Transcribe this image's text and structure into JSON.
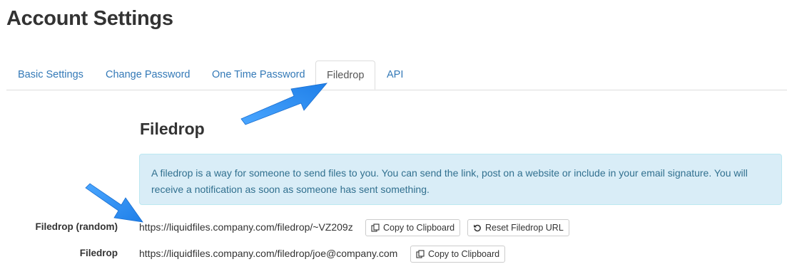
{
  "page": {
    "title": "Account Settings"
  },
  "tabs": [
    {
      "label": "Basic Settings",
      "active": false
    },
    {
      "label": "Change Password",
      "active": false
    },
    {
      "label": "One Time Password",
      "active": false
    },
    {
      "label": "Filedrop",
      "active": true
    },
    {
      "label": "API",
      "active": false
    }
  ],
  "section": {
    "title": "Filedrop",
    "info": "A filedrop is a way for someone to send files to you. You can send the link, post on a website or include in your email signature. You will receive a notification as soon as someone has sent something."
  },
  "rows": {
    "random": {
      "label": "Filedrop (random)",
      "url": "https://liquidfiles.company.com/filedrop/~VZ209z",
      "copy_label": "Copy to Clipboard",
      "reset_label": "Reset Filedrop URL"
    },
    "named": {
      "label": "Filedrop",
      "url": "https://liquidfiles.company.com/filedrop/joe@company.com",
      "copy_label": "Copy to Clipboard"
    }
  },
  "colors": {
    "link": "#3379b7",
    "info_bg": "#d9edf7",
    "info_text": "#31708f",
    "arrow": "#2b8af0"
  },
  "icons": [
    "copy-icon",
    "reset-icon",
    "annotation-arrow"
  ]
}
